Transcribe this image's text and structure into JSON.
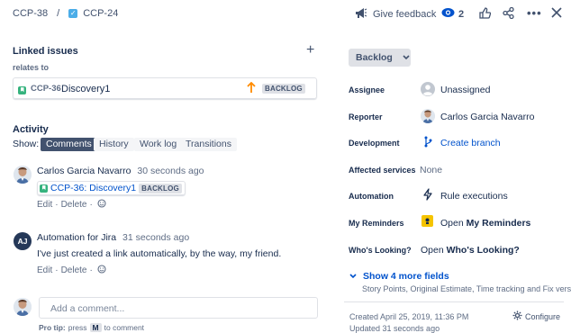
{
  "header": {
    "breadcrumb_parent": "CCP-38",
    "breadcrumb_sep": "/",
    "breadcrumb_current": "CCP-24",
    "give_feedback": "Give feedback",
    "watch_count": "2"
  },
  "linked_issues": {
    "title": "Linked issues",
    "add": "+",
    "relation": "relates to",
    "item": {
      "key": "CCP-36",
      "summary": "Discovery1",
      "status": "BACKLOG"
    }
  },
  "activity": {
    "title": "Activity",
    "show_label": "Show:",
    "tabs": [
      "Comments",
      "History",
      "Work log",
      "Transitions"
    ],
    "comments": [
      {
        "author": "Carlos Garcia Navarro",
        "time": "30 seconds ago",
        "link_text": "CCP-36: Discovery1",
        "link_status": "BACKLOG",
        "edit": "Edit",
        "dot": "·",
        "delete": "Delete",
        "dot2": "·"
      },
      {
        "author": "Automation for Jira",
        "initials": "AJ",
        "time": "31 seconds ago",
        "body": "I've just created a link automatically, by the way, my friend.",
        "edit": "Edit",
        "dot": "·",
        "delete": "Delete",
        "dot2": "·"
      }
    ],
    "add_placeholder": "Add a comment...",
    "pro_tip_prefix": "Pro tip:",
    "pro_tip_press": "press",
    "pro_tip_key": "M",
    "pro_tip_suffix": "to comment"
  },
  "sidebar": {
    "status_button": "Backlog",
    "fields": [
      {
        "label": "Assignee",
        "value": "Unassigned"
      },
      {
        "label": "Reporter",
        "value": "Carlos Garcia Navarro"
      },
      {
        "label": "Development",
        "value": "Create branch"
      },
      {
        "label": "Affected services",
        "value": "None"
      },
      {
        "label": "Automation",
        "value": "Rule executions"
      },
      {
        "label": "My Reminders",
        "value_prefix": "Open",
        "value_bold": "My Reminders"
      },
      {
        "label": "Who's Looking?",
        "value_prefix": "Open",
        "value_bold": "Who's Looking?"
      }
    ],
    "show_more": "Show 4 more fields",
    "show_more_sub": "Story Points, Original Estimate, Time tracking and Fix versio...",
    "created": "Created April 25, 2019, 11:36 PM",
    "updated": "Updated 31 seconds ago",
    "configure": "Configure"
  },
  "colors": {
    "accent": "#0052cc",
    "story_green": "#36b37e",
    "priority_orange": "#ff8b00",
    "text": "#172b4d",
    "muted": "#5e6c84"
  }
}
